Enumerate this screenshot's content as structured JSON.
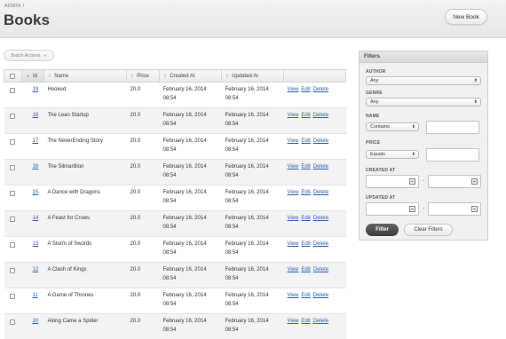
{
  "header": {
    "breadcrumb": "ADMIN",
    "breadcrumb_sep": "/",
    "title": "Books",
    "new_button": "New Book"
  },
  "batch_actions": {
    "label": "Batch Actions",
    "caret": "▼"
  },
  "table": {
    "columns": [
      {
        "label": "Id",
        "sort_icon": "▲",
        "sorted": true
      },
      {
        "label": "Name",
        "sort_icon": "⇕",
        "sorted": false
      },
      {
        "label": "Price",
        "sort_icon": "⇕",
        "sorted": false
      },
      {
        "label": "Created At",
        "sort_icon": "⇕",
        "sorted": false
      },
      {
        "label": "Updated At",
        "sort_icon": "⇕",
        "sorted": false
      }
    ],
    "actions": {
      "view": "View",
      "edit": "Edit",
      "delete": "Delete"
    },
    "rows": [
      {
        "id": "19",
        "name": "Hooked",
        "price": "20.0",
        "created_date": "February 16, 2014",
        "created_time": "08:54",
        "updated_date": "February 16, 2014",
        "updated_time": "08:54"
      },
      {
        "id": "18",
        "name": "The Lean Startup",
        "price": "20.0",
        "created_date": "February 16, 2014",
        "created_time": "08:54",
        "updated_date": "February 16, 2014",
        "updated_time": "08:54"
      },
      {
        "id": "17",
        "name": "The NeverEnding Story",
        "price": "20.0",
        "created_date": "February 16, 2014",
        "created_time": "08:54",
        "updated_date": "February 16, 2014",
        "updated_time": "08:54"
      },
      {
        "id": "16",
        "name": "The Silmarillion",
        "price": "20.0",
        "created_date": "February 16, 2014",
        "created_time": "08:54",
        "updated_date": "February 16, 2014",
        "updated_time": "08:54"
      },
      {
        "id": "15",
        "name": "A Dance with Dragons",
        "price": "20.0",
        "created_date": "February 16, 2014",
        "created_time": "08:54",
        "updated_date": "February 16, 2014",
        "updated_time": "08:54"
      },
      {
        "id": "14",
        "name": "A Feast for Crows",
        "price": "20.0",
        "created_date": "February 16, 2014",
        "created_time": "08:54",
        "updated_date": "February 16, 2014",
        "updated_time": "08:54"
      },
      {
        "id": "13",
        "name": "A Storm of Swords",
        "price": "20.0",
        "created_date": "February 16, 2014",
        "created_time": "08:54",
        "updated_date": "February 16, 2014",
        "updated_time": "08:54"
      },
      {
        "id": "12",
        "name": "A Clash of Kings",
        "price": "20.0",
        "created_date": "February 16, 2014",
        "created_time": "08:54",
        "updated_date": "February 16, 2014",
        "updated_time": "08:54"
      },
      {
        "id": "11",
        "name": "A Game of Thrones",
        "price": "20.0",
        "created_date": "February 16, 2014",
        "created_time": "08:54",
        "updated_date": "February 16, 2014",
        "updated_time": "08:54"
      },
      {
        "id": "10",
        "name": "Along Came a Spider",
        "price": "20.0",
        "created_date": "February 16, 2014",
        "created_time": "08:54",
        "updated_date": "February 16, 2014",
        "updated_time": "08:54"
      }
    ]
  },
  "filters": {
    "title": "Filters",
    "author_label": "AUTHOR",
    "author_value": "Any",
    "genre_label": "GENRE",
    "genre_value": "Any",
    "name_label": "NAME",
    "name_op": "Contains",
    "name_value": "",
    "price_label": "PRICE",
    "price_op": "Equals",
    "price_value": "",
    "created_label": "CREATED AT",
    "updated_label": "UPDATED AT",
    "range_sep": "-",
    "filter_button": "Filter",
    "clear_button": "Clear Filters"
  },
  "colors": {
    "link": "#2a5db0",
    "filter_button": "#4a4a4a"
  }
}
